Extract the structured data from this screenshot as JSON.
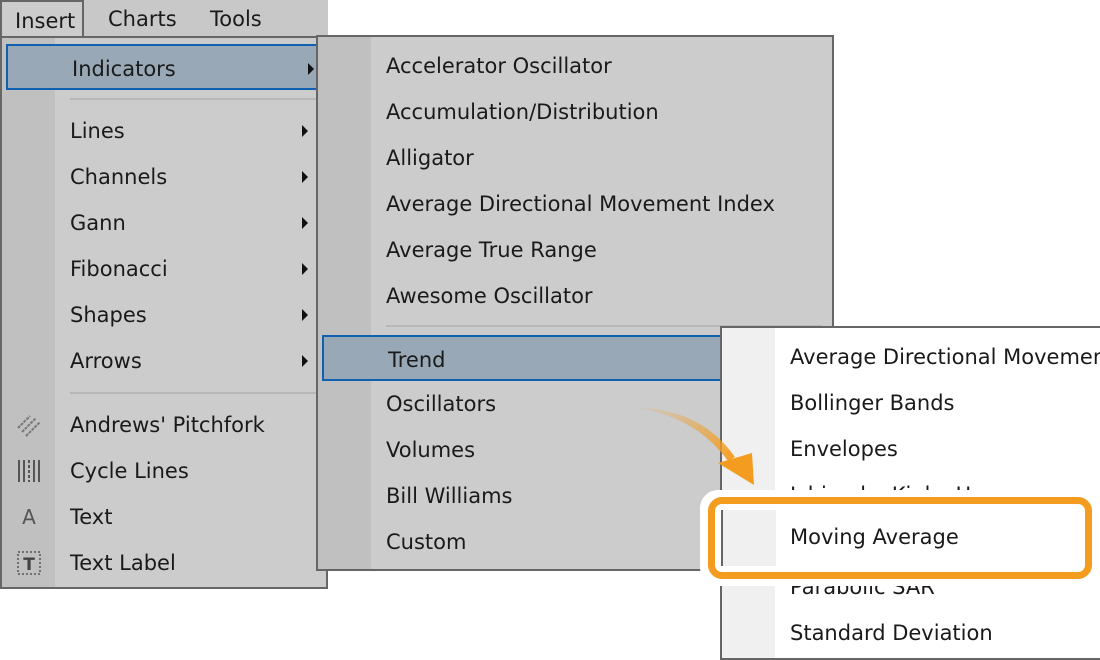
{
  "menubar": {
    "items": [
      {
        "label": "Insert",
        "active": true
      },
      {
        "label": "Charts"
      },
      {
        "label": "Tools"
      }
    ]
  },
  "insert_menu": {
    "items": [
      {
        "label": "Indicators",
        "submenu": true,
        "selected": true
      },
      {
        "label": "Lines",
        "submenu": true
      },
      {
        "label": "Channels",
        "submenu": true
      },
      {
        "label": "Gann",
        "submenu": true
      },
      {
        "label": "Fibonacci",
        "submenu": true
      },
      {
        "label": "Shapes",
        "submenu": true
      },
      {
        "label": "Arrows",
        "submenu": true
      },
      {
        "label": "Andrews' Pitchfork",
        "icon": "pitchfork-icon"
      },
      {
        "label": "Cycle Lines",
        "icon": "cycle-lines-icon"
      },
      {
        "label": "Text",
        "icon": "text-icon"
      },
      {
        "label": "Text Label",
        "icon": "text-label-icon"
      }
    ]
  },
  "indicators_menu": {
    "items": [
      {
        "label": "Accelerator Oscillator"
      },
      {
        "label": "Accumulation/Distribution"
      },
      {
        "label": "Alligator"
      },
      {
        "label": "Average Directional Movement Index"
      },
      {
        "label": "Average True Range"
      },
      {
        "label": "Awesome Oscillator"
      },
      {
        "label": "Trend",
        "selected": true
      },
      {
        "label": "Oscillators"
      },
      {
        "label": "Volumes"
      },
      {
        "label": "Bill Williams"
      },
      {
        "label": "Custom"
      }
    ]
  },
  "trend_menu": {
    "items": [
      {
        "label": "Average Directional Movement Index"
      },
      {
        "label": "Bollinger Bands"
      },
      {
        "label": "Envelopes"
      },
      {
        "label": "Ichimoku Kinko Hyo"
      },
      {
        "label": "Moving Average",
        "highlighted": true
      },
      {
        "label": "Parabolic SAR"
      },
      {
        "label": "Standard Deviation"
      }
    ]
  },
  "annotation": {
    "highlight_color": "#f39c1f",
    "target": "Moving Average"
  }
}
